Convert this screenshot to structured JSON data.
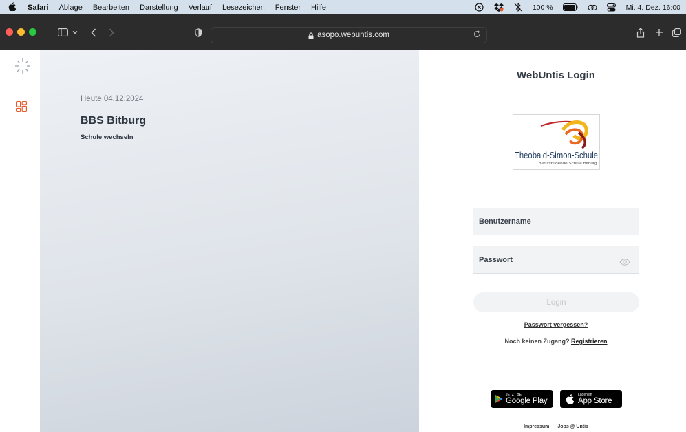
{
  "menubar": {
    "app_name": "Safari",
    "menus": [
      "Ablage",
      "Bearbeiten",
      "Darstellung",
      "Verlauf",
      "Lesezeichen",
      "Fenster",
      "Hilfe"
    ],
    "battery_text": "100 %",
    "datetime": "Mi. 4. Dez. 16:00"
  },
  "browser": {
    "url": "asopo.webuntis.com",
    "traffic_colors": [
      "#fe5f57",
      "#febc2e",
      "#28c840"
    ]
  },
  "left_panel": {
    "today_label": "Heute 04.12.2024",
    "school_name": "BBS Bitburg",
    "change_school": "Schule wechseln"
  },
  "login": {
    "title": "WebUntis Login",
    "logo_name": "Theobald-Simon-Schule",
    "logo_subtitle": "Berufsbildende Schule Bitburg",
    "username_placeholder": "Benutzername",
    "password_placeholder": "Passwort",
    "login_button": "Login",
    "forgot_password": "Passwort vergessen?",
    "no_access_text": "Noch keinen Zugang?",
    "register_link": "Registrieren",
    "google_play_small": "JETZT BEI",
    "google_play_big": "Google Play",
    "app_store_small": "Laden im",
    "app_store_big": "App Store",
    "footer_impressum": "Impressum",
    "footer_jobs": "Jobs @ Untis"
  },
  "colors": {
    "accent": "#e35b2b",
    "menubar_bg": "#d4e0ec",
    "toolbar_bg": "#2c2c2c"
  }
}
